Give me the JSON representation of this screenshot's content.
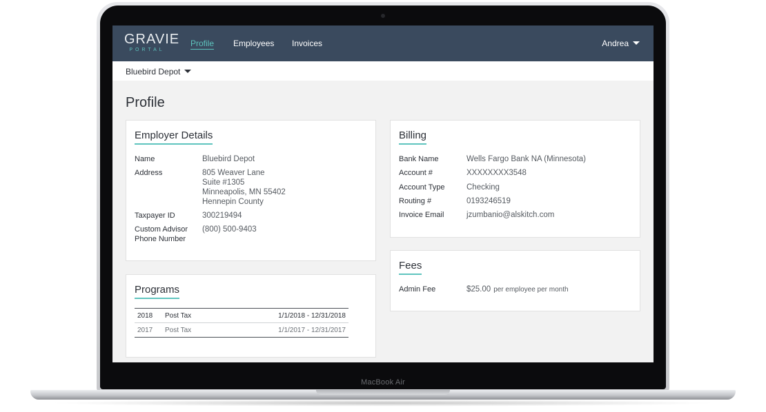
{
  "device": {
    "model_label": "MacBook Air"
  },
  "nav": {
    "logo_main": "GRAVIE",
    "logo_sub": "PORTAL",
    "links": [
      "Profile",
      "Employees",
      "Invoices"
    ],
    "user": "Andrea"
  },
  "subbar": {
    "company": "Bluebird Depot"
  },
  "page": {
    "title": "Profile"
  },
  "employer": {
    "title": "Employer Details",
    "name_label": "Name",
    "name": "Bluebird Depot",
    "address_label": "Address",
    "address": [
      "805 Weaver Lane",
      "Suite #1305",
      "Minneapolis, MN 55402",
      "Hennepin County"
    ],
    "taxpayer_label": "Taxpayer ID",
    "taxpayer": "300219494",
    "advisor_label_1": "Custom Advisor",
    "advisor_label_2": "Phone Number",
    "advisor_phone": "(800) 500-9403"
  },
  "programs": {
    "title": "Programs",
    "rows": [
      {
        "year": "2018",
        "type": "Post Tax",
        "range": "1/1/2018 - 12/31/2018"
      },
      {
        "year": "2017",
        "type": "Post Tax",
        "range": "1/1/2017 - 12/31/2017"
      }
    ]
  },
  "billing": {
    "title": "Billing",
    "bank_label": "Bank Name",
    "bank": "Wells Fargo Bank NA (Minnesota)",
    "account_label": "Account #",
    "account": "XXXXXXXX3548",
    "type_label": "Account Type",
    "type": "Checking",
    "routing_label": "Routing #",
    "routing": "0193246519",
    "email_label": "Invoice Email",
    "email": "jzumbanio@alskitch.com"
  },
  "fees": {
    "title": "Fees",
    "admin_label": "Admin Fee",
    "admin_amount": "$25.00",
    "admin_note": "per employee per month"
  },
  "colors": {
    "nav_bg": "#3a4a5e",
    "accent": "#5ec4be",
    "page_bg": "#f2f2f2"
  }
}
